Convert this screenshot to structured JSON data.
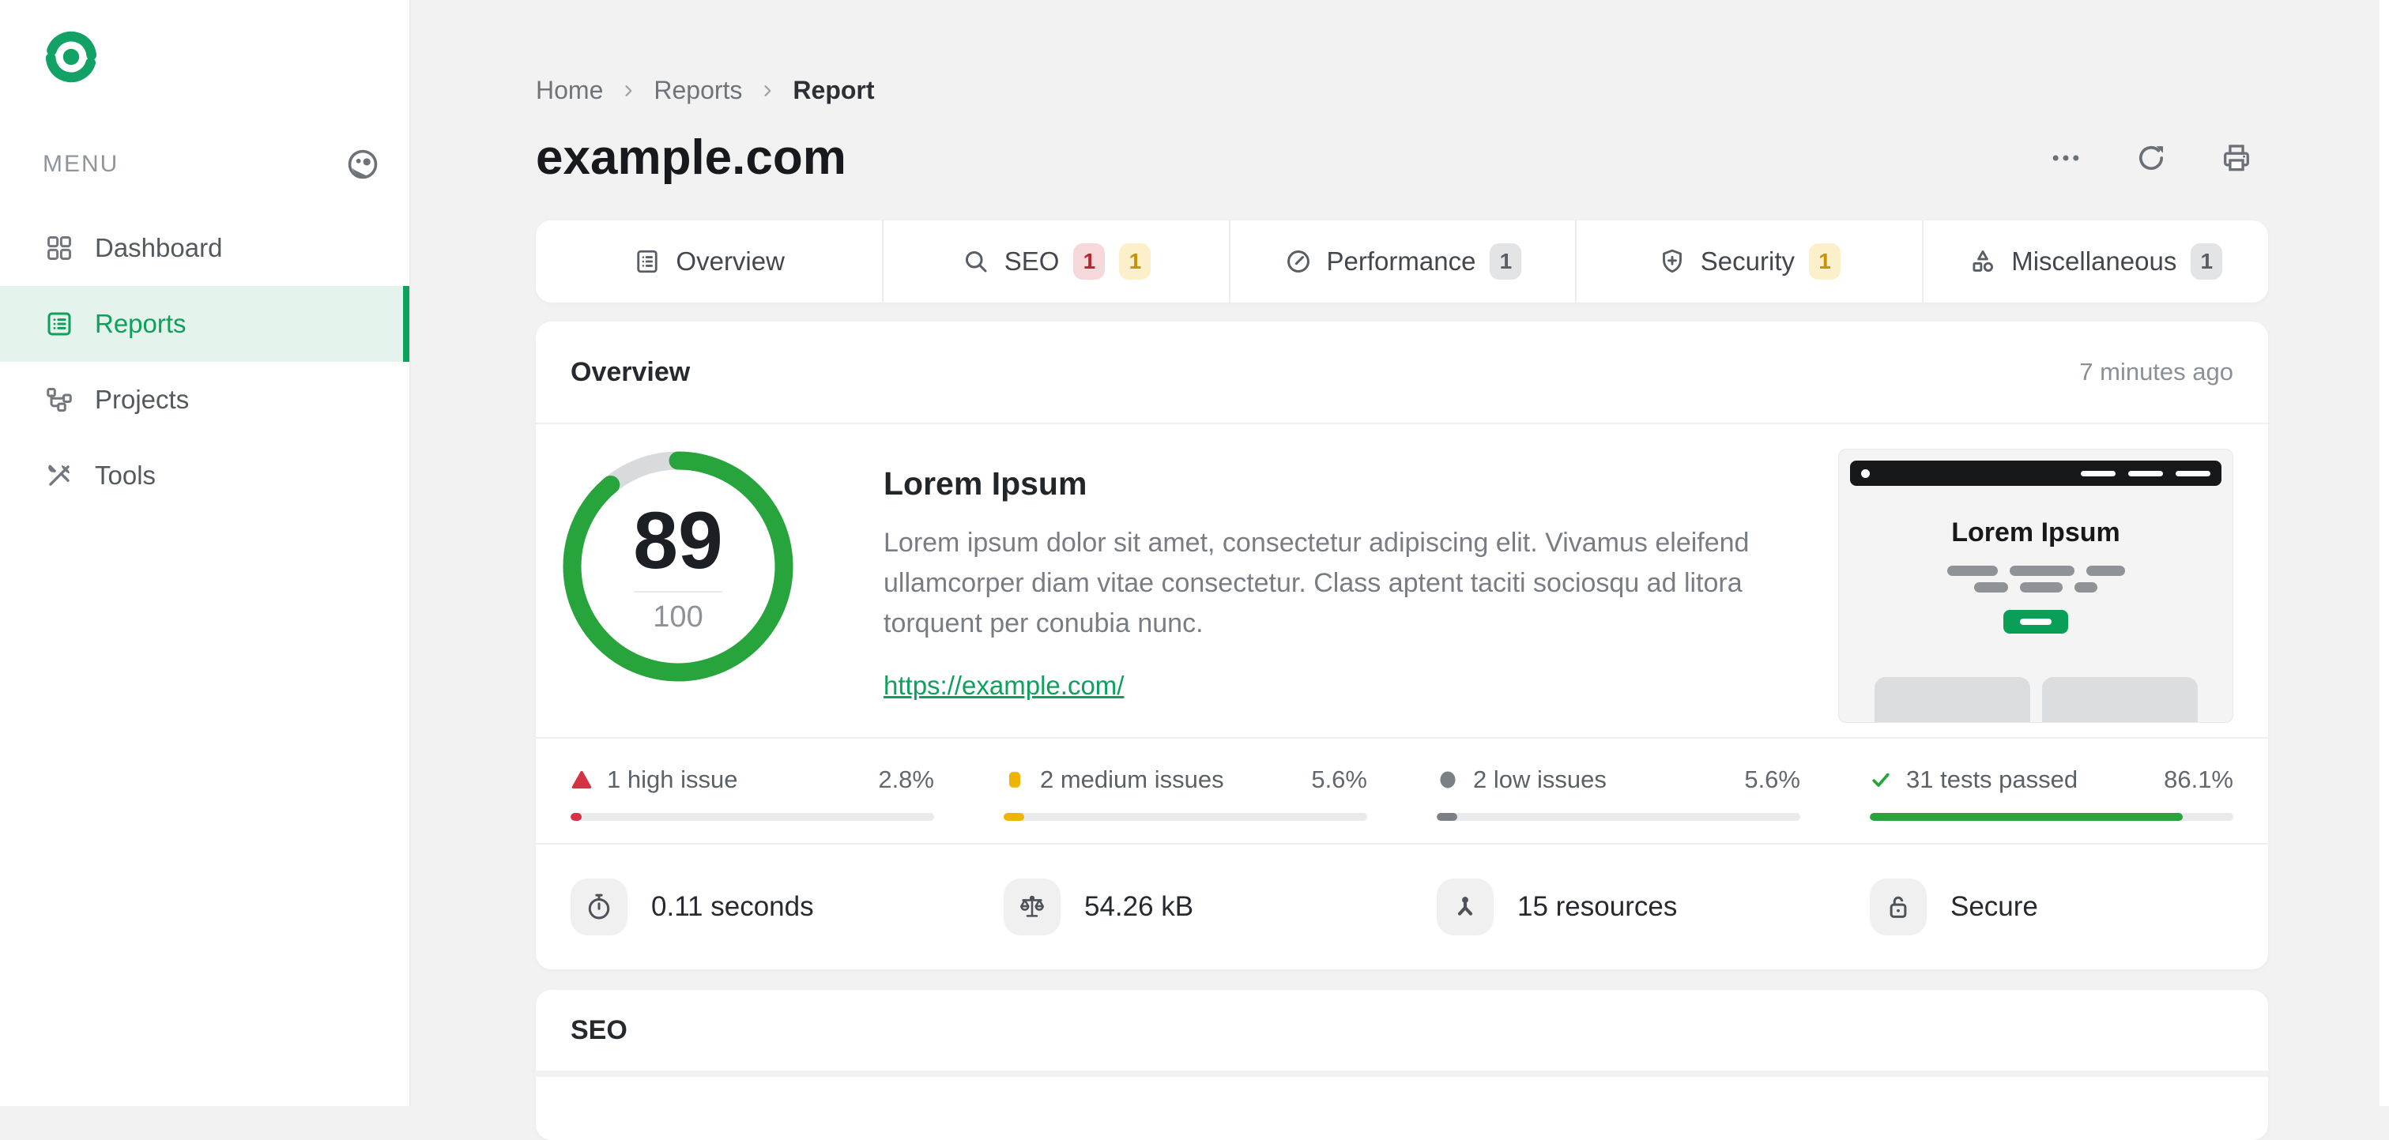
{
  "colors": {
    "accent_green": "#0ea05d",
    "passed_green": "#27a53c",
    "high_red": "#d53345",
    "medium_yellow": "#f0b400",
    "low_gray": "#7b8086"
  },
  "sidebar": {
    "menu_label": "MENU",
    "items": [
      {
        "label": "Dashboard",
        "icon": "dashboard-grid-icon",
        "active": false
      },
      {
        "label": "Reports",
        "icon": "reports-icon",
        "active": true
      },
      {
        "label": "Projects",
        "icon": "projects-icon",
        "active": false
      },
      {
        "label": "Tools",
        "icon": "tools-icon",
        "active": false
      }
    ]
  },
  "header": {
    "breadcrumb": [
      {
        "label": "Home"
      },
      {
        "label": "Reports"
      },
      {
        "label": "Report"
      }
    ],
    "title": "example.com",
    "actions": [
      "more-options",
      "refresh",
      "print"
    ]
  },
  "tabs": [
    {
      "label": "Overview",
      "icon": "overview-list-icon",
      "badges": []
    },
    {
      "label": "SEO",
      "icon": "search-icon",
      "badges": [
        {
          "count": "1",
          "type": "high"
        },
        {
          "count": "1",
          "type": "medium"
        }
      ]
    },
    {
      "label": "Performance",
      "icon": "gauge-icon",
      "badges": [
        {
          "count": "1",
          "type": "neutral"
        }
      ]
    },
    {
      "label": "Security",
      "icon": "shield-icon",
      "badges": [
        {
          "count": "1",
          "type": "medium"
        }
      ]
    },
    {
      "label": "Miscellaneous",
      "icon": "shapes-icon",
      "badges": [
        {
          "count": "1",
          "type": "neutral"
        }
      ]
    }
  ],
  "overview": {
    "section_title": "Overview",
    "updated": "7 minutes ago",
    "score": {
      "value": "89",
      "max": "100"
    },
    "site": {
      "heading": "Lorem Ipsum",
      "description": "Lorem ipsum dolor sit amet, consectetur adipiscing elit. Vivamus eleifend ullamcorper diam vitae consectetur. Class aptent taciti sociosqu ad litora torquent per conubia nunc.",
      "url": "https://example.com/"
    },
    "preview": {
      "heading": "Lorem Ipsum"
    },
    "stats": [
      {
        "label": "1 high issue",
        "percent": "2.8%",
        "value": 2.8,
        "severity": "high",
        "color": "#d53345",
        "glyph": "triangle-icon"
      },
      {
        "label": "2 medium issues",
        "percent": "5.6%",
        "value": 5.6,
        "severity": "medium",
        "color": "#f0b400",
        "glyph": "square-icon"
      },
      {
        "label": "2 low issues",
        "percent": "5.6%",
        "value": 5.6,
        "severity": "low",
        "color": "#7b8086",
        "glyph": "circle-icon"
      },
      {
        "label": "31 tests passed",
        "percent": "86.1%",
        "value": 86.1,
        "severity": "passed",
        "color": "#27a53c",
        "glyph": "check-icon"
      }
    ],
    "metrics": [
      {
        "label": "0.11 seconds",
        "icon": "stopwatch-icon"
      },
      {
        "label": "54.26 kB",
        "icon": "scale-icon"
      },
      {
        "label": "15 resources",
        "icon": "resources-icon"
      },
      {
        "label": "Secure",
        "icon": "lock-icon"
      }
    ]
  },
  "seo_section": {
    "title": "SEO"
  }
}
